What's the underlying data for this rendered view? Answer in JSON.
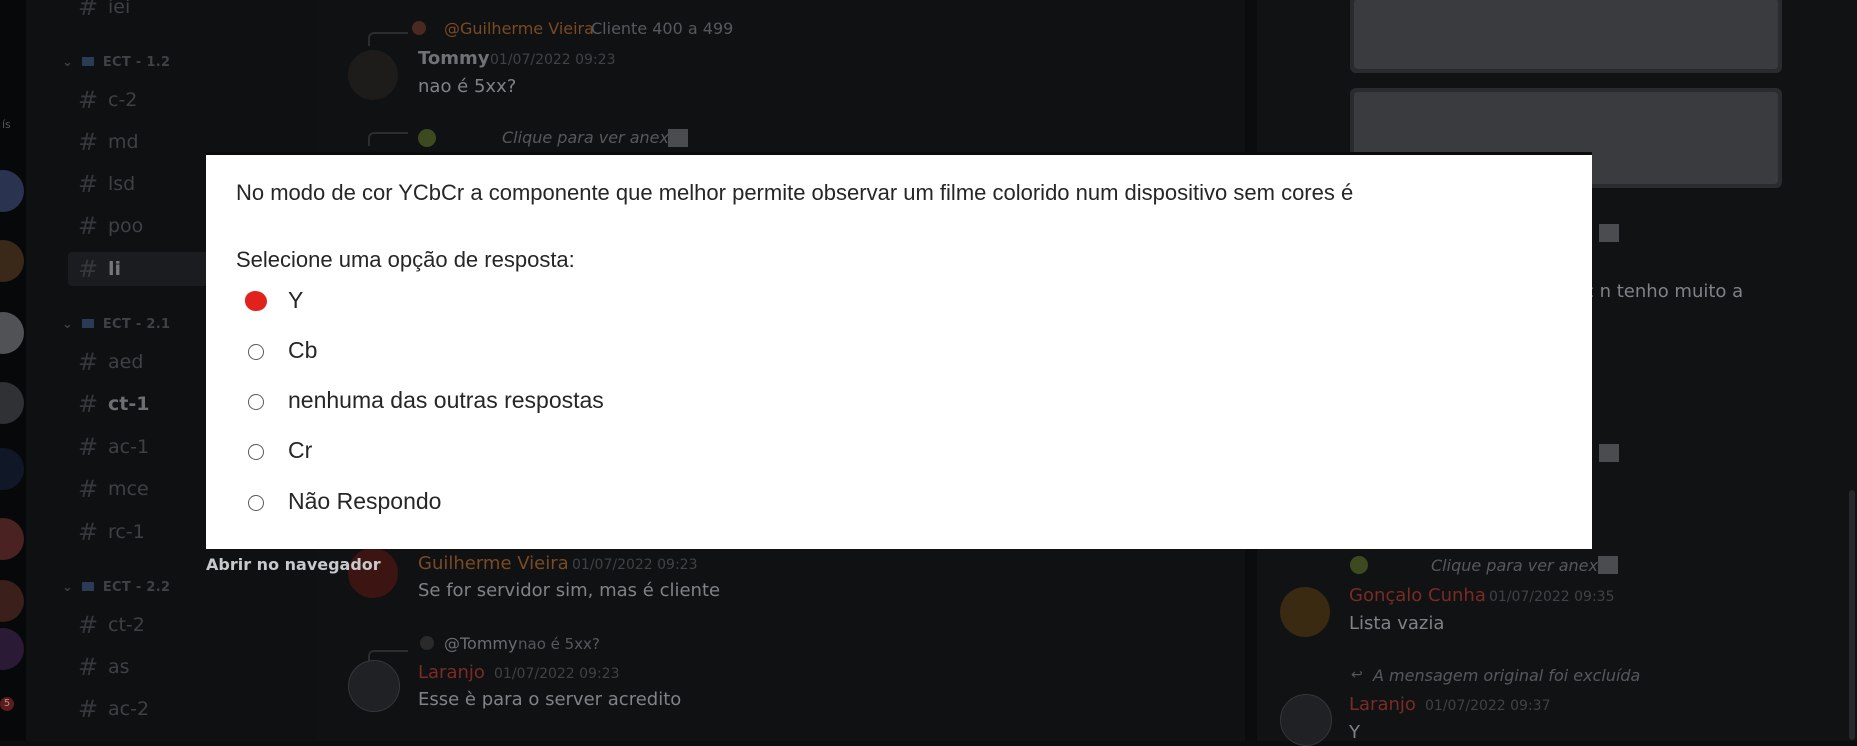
{
  "sidebar": {
    "top_channel": "iei",
    "categories": [
      {
        "label": "ECT - 1.2",
        "channels": [
          "c-2",
          "md",
          "lsd",
          "poo",
          "li"
        ]
      },
      {
        "label": "ECT - 2.1",
        "channels": [
          "aed",
          "ct-1",
          "ac-1",
          "mce",
          "rc-1"
        ]
      },
      {
        "label": "ECT - 2.2",
        "channels": [
          "ct-2",
          "as",
          "ac-2"
        ]
      }
    ],
    "rail_label": "ís",
    "rail_badge": "5"
  },
  "chat": {
    "msg1": {
      "reply_user": "@Guilherme Vieira",
      "reply_text": "Cliente 400 a 499",
      "user": "Tommy",
      "timestamp": "01/07/2022 09:23",
      "text": "nao é 5xx?"
    },
    "msg2": {
      "attachment_text": "Clique para ver anexo"
    },
    "msg3": {
      "user": "Guilherme Vieira",
      "timestamp": "01/07/2022 09:23",
      "text": "Se for servidor sim, mas é cliente"
    },
    "msg4": {
      "reply_user": "@Tommy",
      "reply_text": "nao é 5xx?",
      "user": "Laranjo",
      "timestamp": "01/07/2022 09:23",
      "text": "Esse è para o server acredito"
    }
  },
  "thread": {
    "partial_text": "c n tenho muito a",
    "attachment_text": "Clique para ver anexo",
    "msg1": {
      "user": "Gonçalo Cunha",
      "timestamp": "01/07/2022 09:35",
      "text": "Lista vazia"
    },
    "deleted_text": "A mensagem original foi excluída",
    "msg2": {
      "user": "Laranjo",
      "timestamp": "01/07/2022 09:37",
      "text": "Y"
    }
  },
  "quiz": {
    "question": "No modo de cor YCbCr a componente que melhor permite observar um filme colorido num dispositivo sem cores é",
    "prompt": "Selecione uma opção de resposta:",
    "options": [
      {
        "label": "Y",
        "selected": true
      },
      {
        "label": "Cb",
        "selected": false
      },
      {
        "label": "nenhuma das outras respostas",
        "selected": false
      },
      {
        "label": "Cr",
        "selected": false
      },
      {
        "label": "Não Respondo",
        "selected": false
      }
    ],
    "open_link": "Abrir no navegador"
  },
  "colors": {
    "quiz_check": "#e1211c",
    "name_orange": "#a25b1e",
    "name_red": "#7a2b25",
    "text_dim": "#7f8287"
  }
}
